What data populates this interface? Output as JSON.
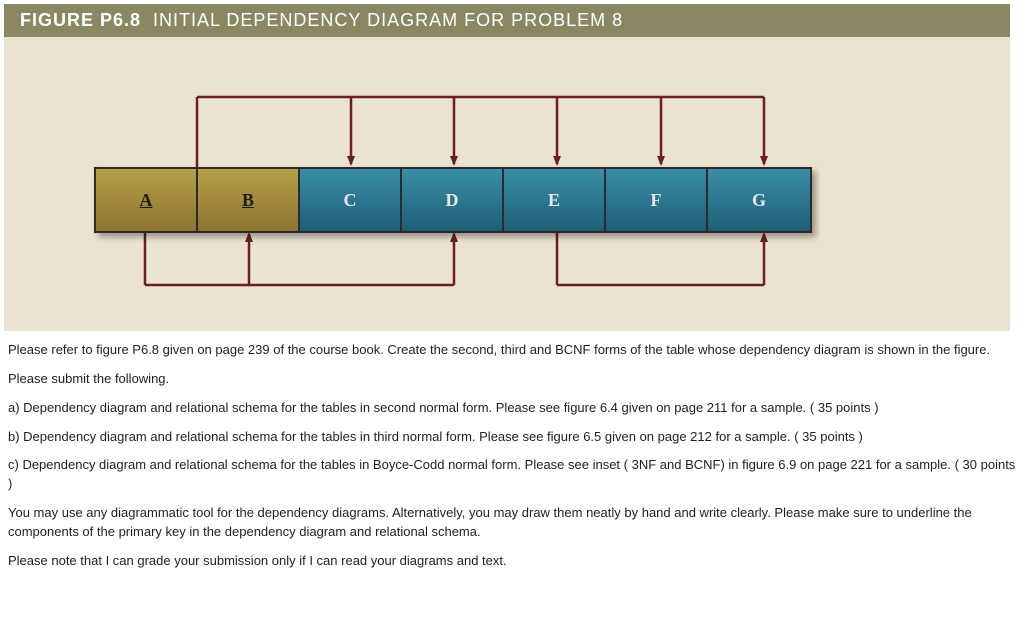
{
  "figure": {
    "label": "FIGURE P6.8",
    "title": "INITIAL DEPENDENCY DIAGRAM FOR PROBLEM 8",
    "cells": {
      "a": "A",
      "b": "B",
      "c": "C",
      "d": "D",
      "e": "E",
      "f": "F",
      "g": "G"
    }
  },
  "paragraphs": {
    "p1": "Please refer to figure P6.8 given on page 239 of the course book. Create the second, third and BCNF forms of the table whose dependency diagram is shown in the figure.",
    "p2": "Please submit the following.",
    "p3": "a) Dependency diagram and relational schema for the tables in second normal form. Please see figure 6.4 given on page 211 for a sample. ( 35 points )",
    "p4": "b) Dependency diagram and relational schema for the tables in third normal form. Please see figure 6.5 given on page 212 for a sample. ( 35 points )",
    "p5": "c)  Dependency diagram and relational schema for the tables in Boyce-Codd normal form. Please see inset ( 3NF and BCNF) in figure 6.9 on page 221 for a sample. ( 30 points )",
    "p6": "You may use any diagrammatic tool for the dependency diagrams. Alternatively, you may draw them neatly by hand and write clearly. Please make sure to underline the components of the primary key in the dependency diagram and relational schema.",
    "p7": "Please note that I can grade your submission only if I can read your diagrams and text."
  }
}
